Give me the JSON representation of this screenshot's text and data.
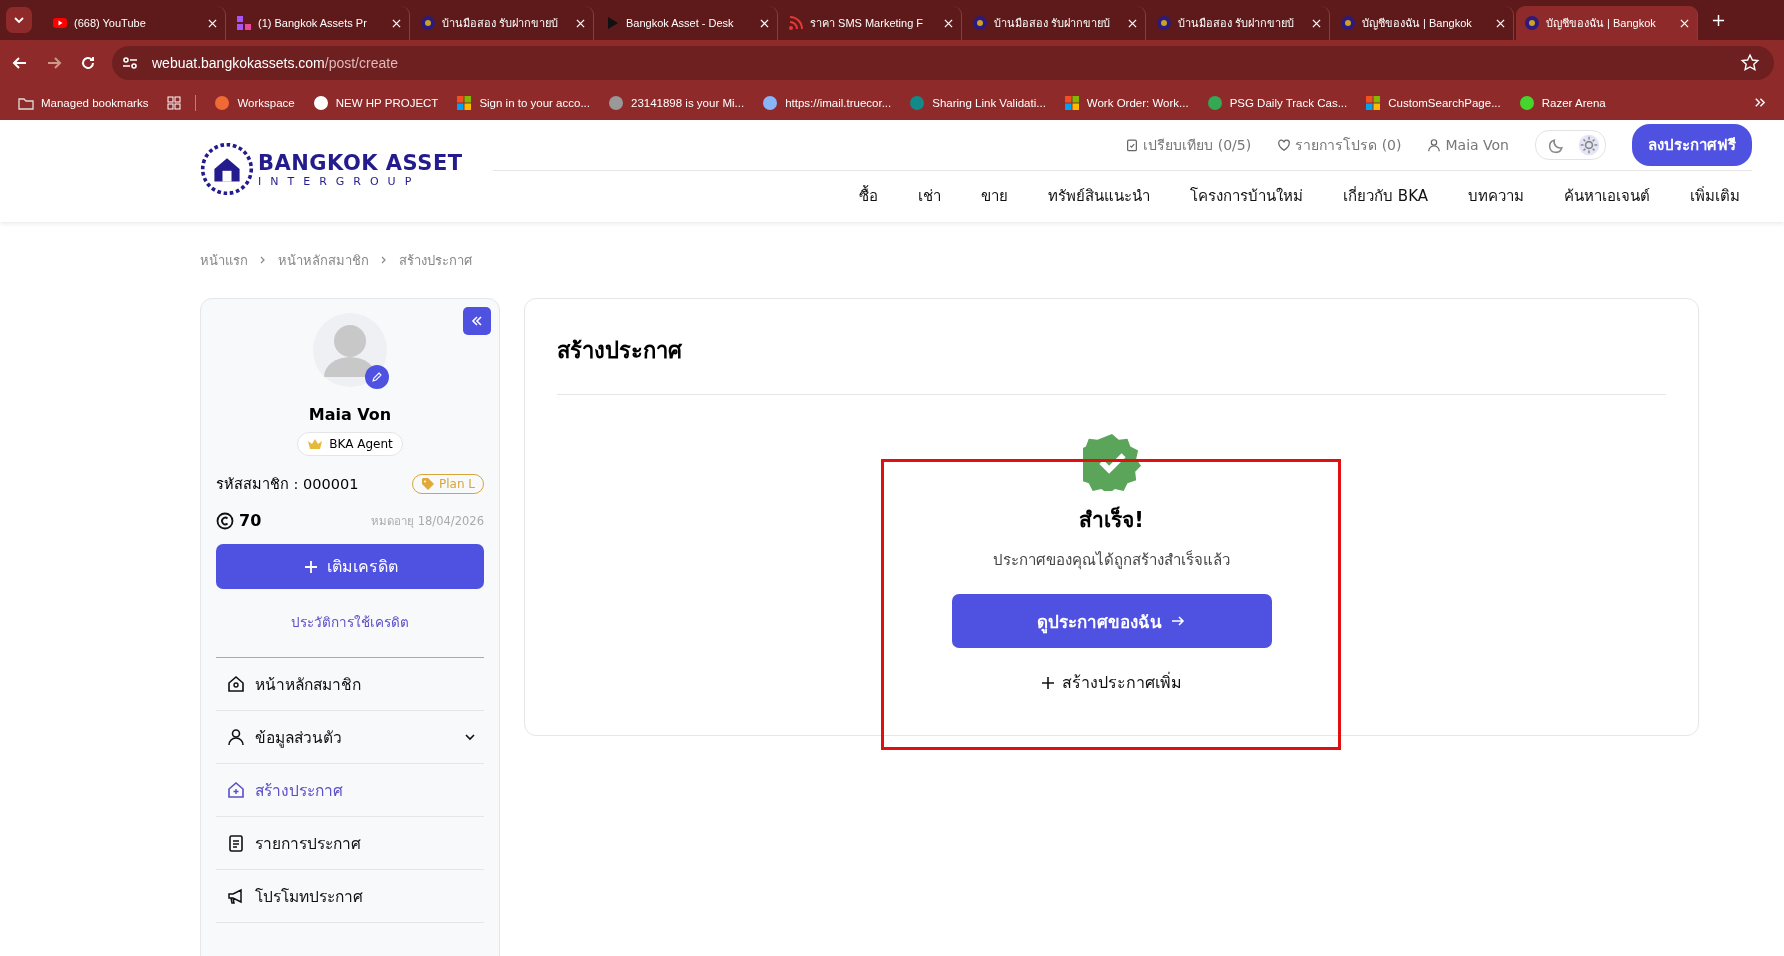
{
  "browser": {
    "tabs": [
      {
        "title": "(668) YouTube",
        "kind": "youtube",
        "selected": false
      },
      {
        "title": "(1) Bangkok Assets Pr",
        "kind": "grid",
        "selected": false
      },
      {
        "title": "บ้านมือสอง รับฝากขายบ้",
        "kind": "site",
        "selected": false
      },
      {
        "title": "Bangkok Asset - Desk",
        "kind": "play",
        "selected": false
      },
      {
        "title": "ราคา SMS Marketing F",
        "kind": "rss",
        "selected": false
      },
      {
        "title": "บ้านมือสอง รับฝากขายบ้",
        "kind": "site",
        "selected": false
      },
      {
        "title": "บ้านมือสอง รับฝากขายบ้",
        "kind": "site",
        "selected": false
      },
      {
        "title": "บัญชีของฉัน | Bangkok",
        "kind": "site",
        "selected": false
      },
      {
        "title": "บัญชีของฉัน | Bangkok",
        "kind": "site",
        "selected": true
      }
    ],
    "url_host": "webuat.bangkokassets.com",
    "url_path": "/post/create",
    "bookmarks": [
      {
        "label": "Managed bookmarks",
        "kind": "folder"
      },
      {
        "kind": "apps"
      },
      {
        "label": "Workspace",
        "kind": "orange"
      },
      {
        "label": "NEW HP PROJECT",
        "kind": "globe"
      },
      {
        "label": "Sign in to your acco...",
        "kind": "ms"
      },
      {
        "label": "23141898 is your Mi...",
        "kind": "mail"
      },
      {
        "label": "https://imail.truecor...",
        "kind": "gem"
      },
      {
        "label": "Sharing Link Validati...",
        "kind": "sp"
      },
      {
        "label": "Work Order: Work...",
        "kind": "ms"
      },
      {
        "label": "PSG Daily Track Cas...",
        "kind": "drive"
      },
      {
        "label": "CustomSearchPage...",
        "kind": "ms"
      },
      {
        "label": "Razer Arena",
        "kind": "razer"
      }
    ]
  },
  "header": {
    "logo_title": "BANGKOK ASSET",
    "logo_sub": "INTERGROUP",
    "compare": "เปรียบเทียบ (0/5)",
    "favorites": "รายการโปรด (0)",
    "user": "Maia Von",
    "dark_mode": false,
    "cta": "ลงประกาศฟรี",
    "nav": [
      "ซื้อ",
      "เช่า",
      "ขาย",
      "ทรัพย์สินแนะนำ",
      "โครงการบ้านใหม่",
      "เกี่ยวกับ BKA",
      "บทความ",
      "ค้นหาเอเจนต์",
      "เพิ่มเติม"
    ]
  },
  "breadcrumb": [
    "หน้าแรก",
    "หน้าหลักสมาชิก",
    "สร้างประกาศ"
  ],
  "sidebar": {
    "name": "Maia Von",
    "role": "BKA Agent",
    "member_id": "รหัสสมาชิก : 000001",
    "plan": "Plan L",
    "credits": "70",
    "expiry": "หมดอายุ 18/04/2026",
    "topup": "เติมเครดิต",
    "history": "ประวัติการใช้เครดิต",
    "menu": [
      {
        "label": "หน้าหลักสมาชิก",
        "kind": "home",
        "selected": false,
        "expandable": false
      },
      {
        "label": "ข้อมูลส่วนตัว",
        "kind": "user",
        "selected": false,
        "expandable": true
      },
      {
        "label": "สร้างประกาศ",
        "kind": "house-plus",
        "selected": true,
        "expandable": false
      },
      {
        "label": "รายการประกาศ",
        "kind": "clipboard",
        "selected": false,
        "expandable": false
      },
      {
        "label": "โปรโมทประกาศ",
        "kind": "megaphone",
        "selected": false,
        "expandable": false
      }
    ]
  },
  "main": {
    "title": "สร้างประกาศ",
    "success_title": "สำเร็จ!",
    "success_text": "ประกาศของคุณได้ถูกสร้างสำเร็จแล้ว",
    "view_button": "ดูประกาศของฉัน",
    "create_more": "สร้างประกาศเพิ่ม"
  }
}
